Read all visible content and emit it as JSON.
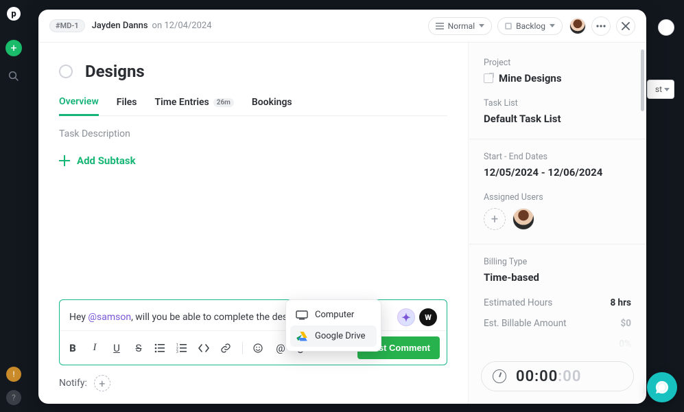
{
  "rail": {
    "logo": "p",
    "plus": "+",
    "warn": "!",
    "help": "?"
  },
  "bg": {
    "listHint": "st"
  },
  "header": {
    "ticket": "#MD-1",
    "author": "Jayden Danns",
    "dateLabel": "on 12/04/2024",
    "priority": "Normal",
    "status": "Backlog"
  },
  "title": "Designs",
  "tabs": {
    "overview": "Overview",
    "files": "Files",
    "time": "Time Entries",
    "timeBadge": "26m",
    "bookings": "Bookings"
  },
  "descLabel": "Task Description",
  "addSubtask": "Add Subtask",
  "editor": {
    "prefix": "Hey ",
    "mention": "@samson",
    "rest": ", will you be able to complete the designs b",
    "post": "Post Comment",
    "aiGlyph": "✦",
    "wGlyph": "W"
  },
  "popover": {
    "computer": "Computer",
    "gdrive": "Google Drive"
  },
  "notify": {
    "label": "Notify:"
  },
  "side": {
    "projectLabel": "Project",
    "projectValue": "Mine Designs",
    "taskListLabel": "Task List",
    "taskListValue": "Default Task List",
    "datesLabel": "Start - End Dates",
    "datesValue": "12/05/2024 - 12/06/2024",
    "assignedLabel": "Assigned Users",
    "billingLabel": "Billing Type",
    "billingValue": "Time-based",
    "estHoursLabel": "Estimated Hours",
    "estHoursValue": "8 hrs",
    "estBillLabel": "Est. Billable Amount",
    "estBillValue": "$0",
    "pctValue": "0%"
  },
  "timer": {
    "hhmm": "00:00",
    "ss": ":00"
  }
}
